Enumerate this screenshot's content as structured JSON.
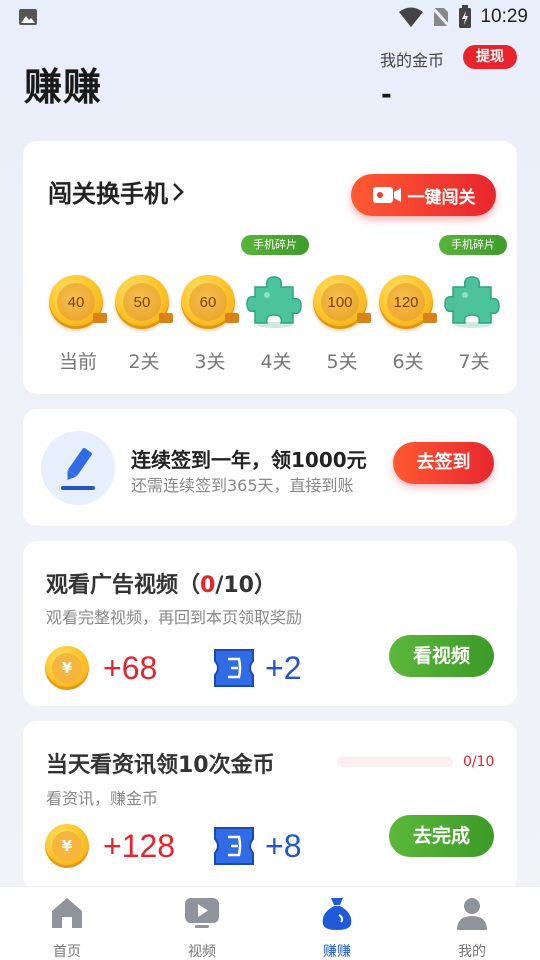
{
  "status_bar": {
    "time": "10:29"
  },
  "header": {
    "title": "赚赚",
    "coin_label": "我的金币",
    "withdraw_label": "提现",
    "coin_value": "-"
  },
  "challenge": {
    "title": "闯关换手机",
    "button_label": "一键闯关",
    "levels": [
      {
        "label": "当前",
        "type": "coin",
        "value": "40"
      },
      {
        "label": "2关",
        "type": "coin",
        "value": "50"
      },
      {
        "label": "3关",
        "type": "coin",
        "value": "60"
      },
      {
        "label": "4关",
        "type": "puzzle",
        "tag": "手机碎片"
      },
      {
        "label": "5关",
        "type": "coin",
        "value": "100"
      },
      {
        "label": "6关",
        "type": "coin",
        "value": "120"
      },
      {
        "label": "7关",
        "type": "puzzle",
        "tag": "手机碎片"
      }
    ]
  },
  "signin": {
    "title": "连续签到一年，领1000元",
    "subtitle": "还需连续签到365天，直接到账",
    "button_label": "去签到"
  },
  "video_task": {
    "title_prefix": "观看广告视频（",
    "progress_done": "0",
    "title_suffix": "/10）",
    "subtitle": "观看完整视频，再回到本页领取奖励",
    "coin_symbol": "¥",
    "coin_reward": "+68",
    "ticket_reward": "+2",
    "button_label": "看视频"
  },
  "news_task": {
    "title": "当天看资讯领10次金币",
    "progress_text": "0/10",
    "progress_fraction": 0,
    "subtitle": "看资讯，赚金币",
    "coin_symbol": "¥",
    "coin_reward": "+128",
    "ticket_reward": "+8",
    "button_label": "去完成"
  },
  "nav": {
    "items": [
      {
        "label": "首页",
        "icon": "home-icon"
      },
      {
        "label": "视频",
        "icon": "video-icon"
      },
      {
        "label": "赚赚",
        "icon": "money-bag-icon",
        "active": true
      },
      {
        "label": "我的",
        "icon": "person-icon"
      }
    ]
  },
  "colors": {
    "accent_red": "#e8232c",
    "accent_green": "#4aa830",
    "accent_blue": "#1f5bd9"
  }
}
